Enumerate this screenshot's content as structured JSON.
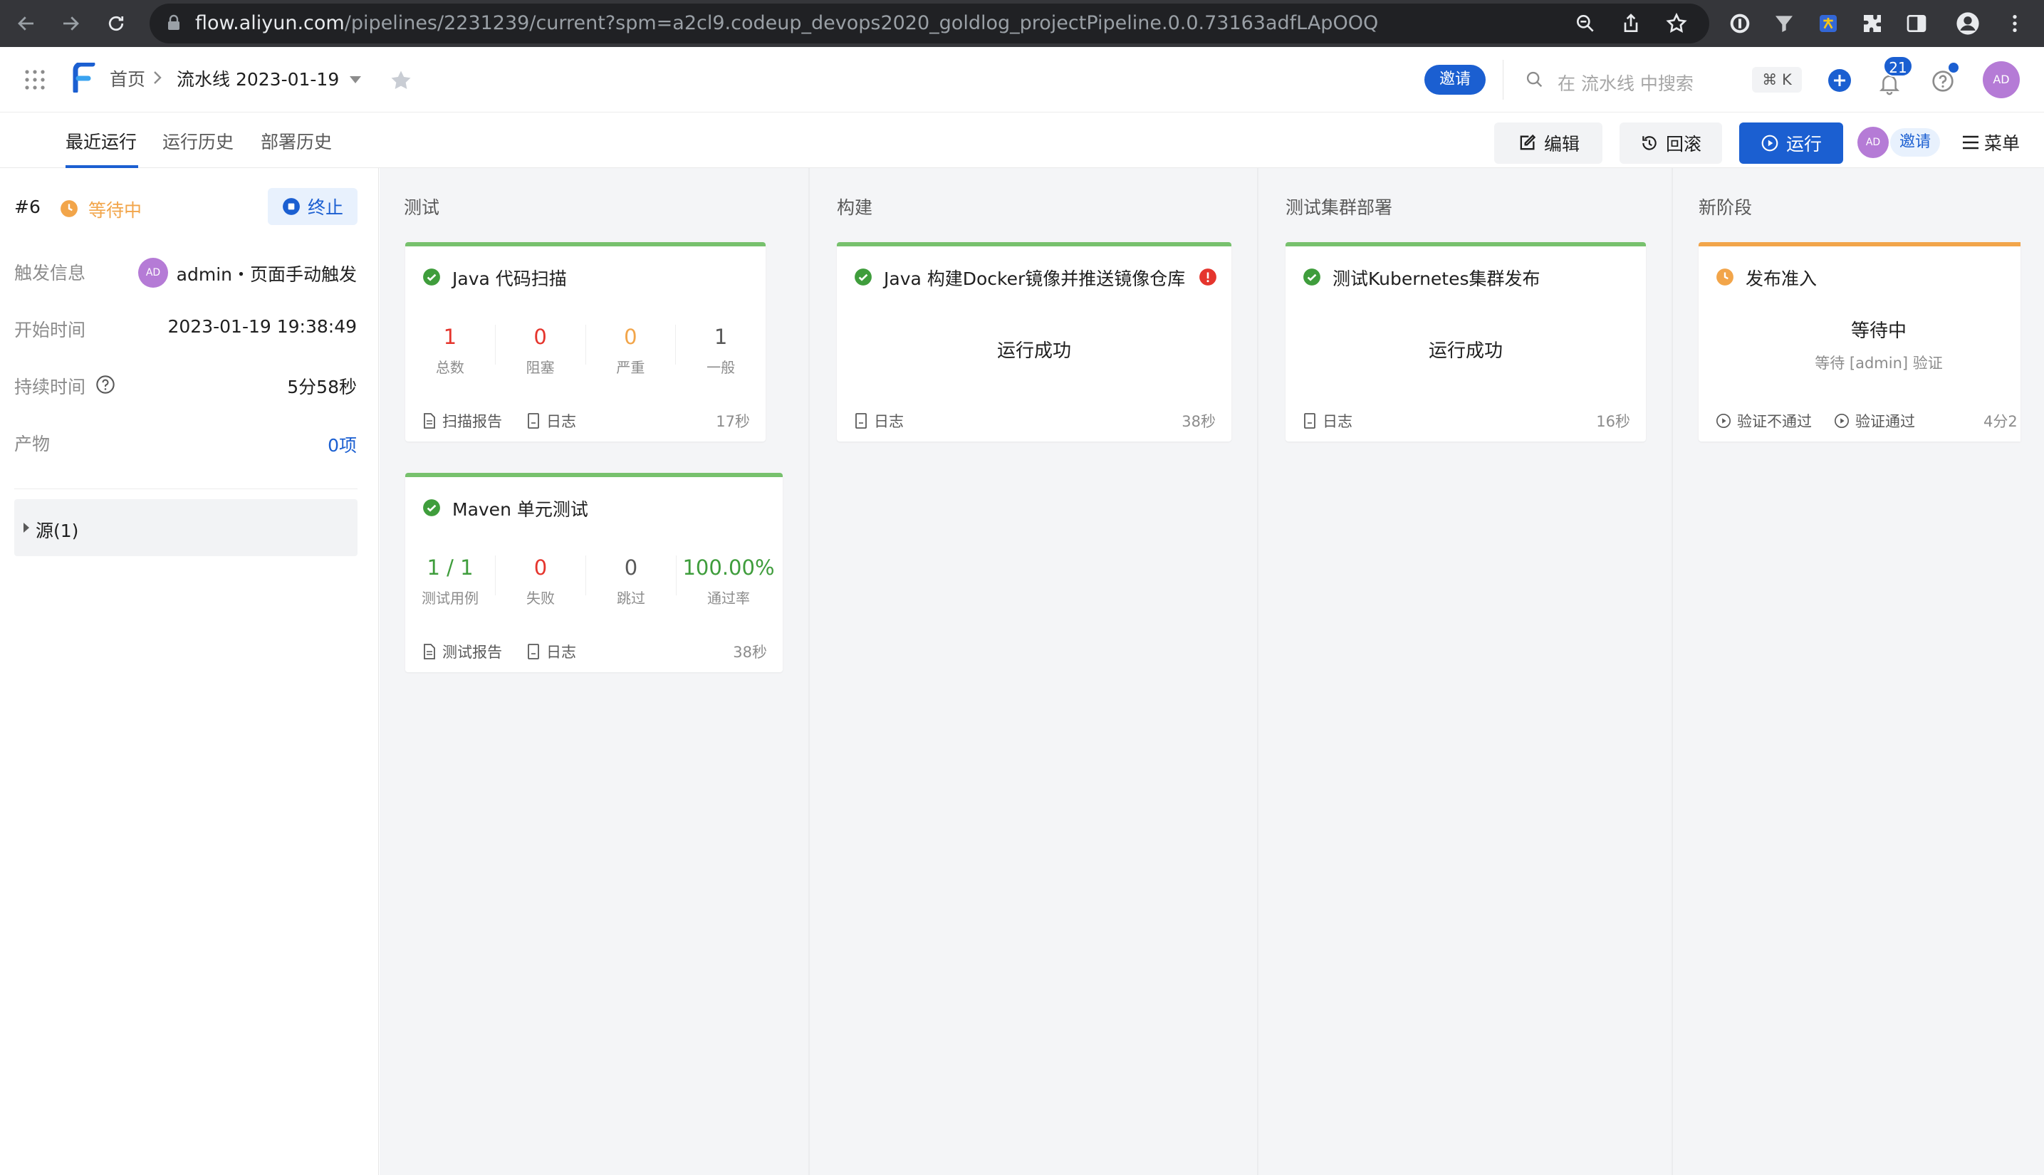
{
  "browser": {
    "url_host": "flow.aliyun.com",
    "url_path": "/pipelines/2231239/current?spm=a2cl9.codeup_devops2020_goldlog_projectPipeline.0.0.73163adfLApOOQ"
  },
  "header": {
    "logo": "F",
    "breadcrumb_home": "首页",
    "pipeline_name": "流水线 2023-01-19",
    "invite_label": "邀请",
    "search_placeholder": "在 流水线 中搜索",
    "shortcut": "⌘ K",
    "notification_count": "21",
    "avatar": "AD"
  },
  "tabs": [
    "最近运行",
    "运行历史",
    "部署历史"
  ],
  "toolbar": {
    "edit_label": "编辑",
    "rollback_label": "回滚",
    "run_label": "运行",
    "avatar": "AD",
    "invite_label": "邀请",
    "menu_label": "菜单"
  },
  "run": {
    "number": "#6",
    "status": "等待中",
    "stop_label": "终止",
    "trigger_label": "触发信息",
    "trigger_avatar": "AD",
    "trigger_value": "admin・页面手动触发",
    "start_label": "开始时间",
    "start_value": "2023-01-19 19:38:49",
    "duration_label": "持续时间",
    "duration_value": "5分58秒",
    "artifacts_label": "产物",
    "artifacts_value": "0项",
    "source_label": "源(1)"
  },
  "stages": {
    "test": {
      "title": "测试",
      "scan": {
        "title": "Java 代码扫描",
        "metrics": [
          {
            "value": "1",
            "label": "总数",
            "color": "#e5352d"
          },
          {
            "value": "0",
            "label": "阻塞",
            "color": "#e5352d"
          },
          {
            "value": "0",
            "label": "严重",
            "color": "#f2a54a"
          },
          {
            "value": "1",
            "label": "一般",
            "color": "#595959"
          }
        ],
        "report": "扫描报告",
        "log": "日志",
        "duration": "17秒"
      },
      "unit": {
        "title": "Maven 单元测试",
        "metrics": [
          {
            "value": "1 / 1",
            "label": "测试用例",
            "color": "#3f9d3c"
          },
          {
            "value": "0",
            "label": "失败",
            "color": "#e5352d"
          },
          {
            "value": "0",
            "label": "跳过",
            "color": "#595959"
          },
          {
            "value": "100.00%",
            "label": "通过率",
            "color": "#3f9d3c"
          }
        ],
        "report": "测试报告",
        "log": "日志",
        "duration": "38秒"
      }
    },
    "build": {
      "title": "构建",
      "job": {
        "title": "Java 构建Docker镜像并推送镜像仓库",
        "status": "运行成功",
        "log": "日志",
        "duration": "38秒"
      }
    },
    "deploy": {
      "title": "测试集群部署",
      "job": {
        "title": "测试Kubernetes集群发布",
        "status": "运行成功",
        "log": "日志",
        "duration": "16秒"
      }
    },
    "new": {
      "title": "新阶段",
      "job": {
        "title": "发布准入",
        "status": "等待中",
        "sub": "等待 [admin] 验证",
        "reject": "验证不通过",
        "approve": "验证通过",
        "duration": "4分2"
      }
    }
  }
}
